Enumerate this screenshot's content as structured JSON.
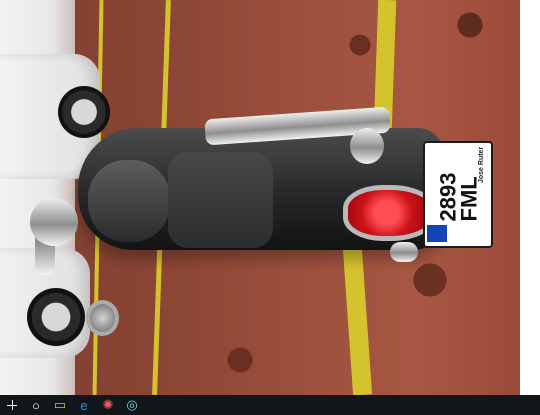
{
  "photo": {
    "license_plate": "2893 FML",
    "plate_maker": "Jose Ruter"
  },
  "taskbar": {
    "icons": [
      "windows-icon",
      "search-icon",
      "folder-icon",
      "edge-icon",
      "paint-icon",
      "app-icon"
    ]
  }
}
